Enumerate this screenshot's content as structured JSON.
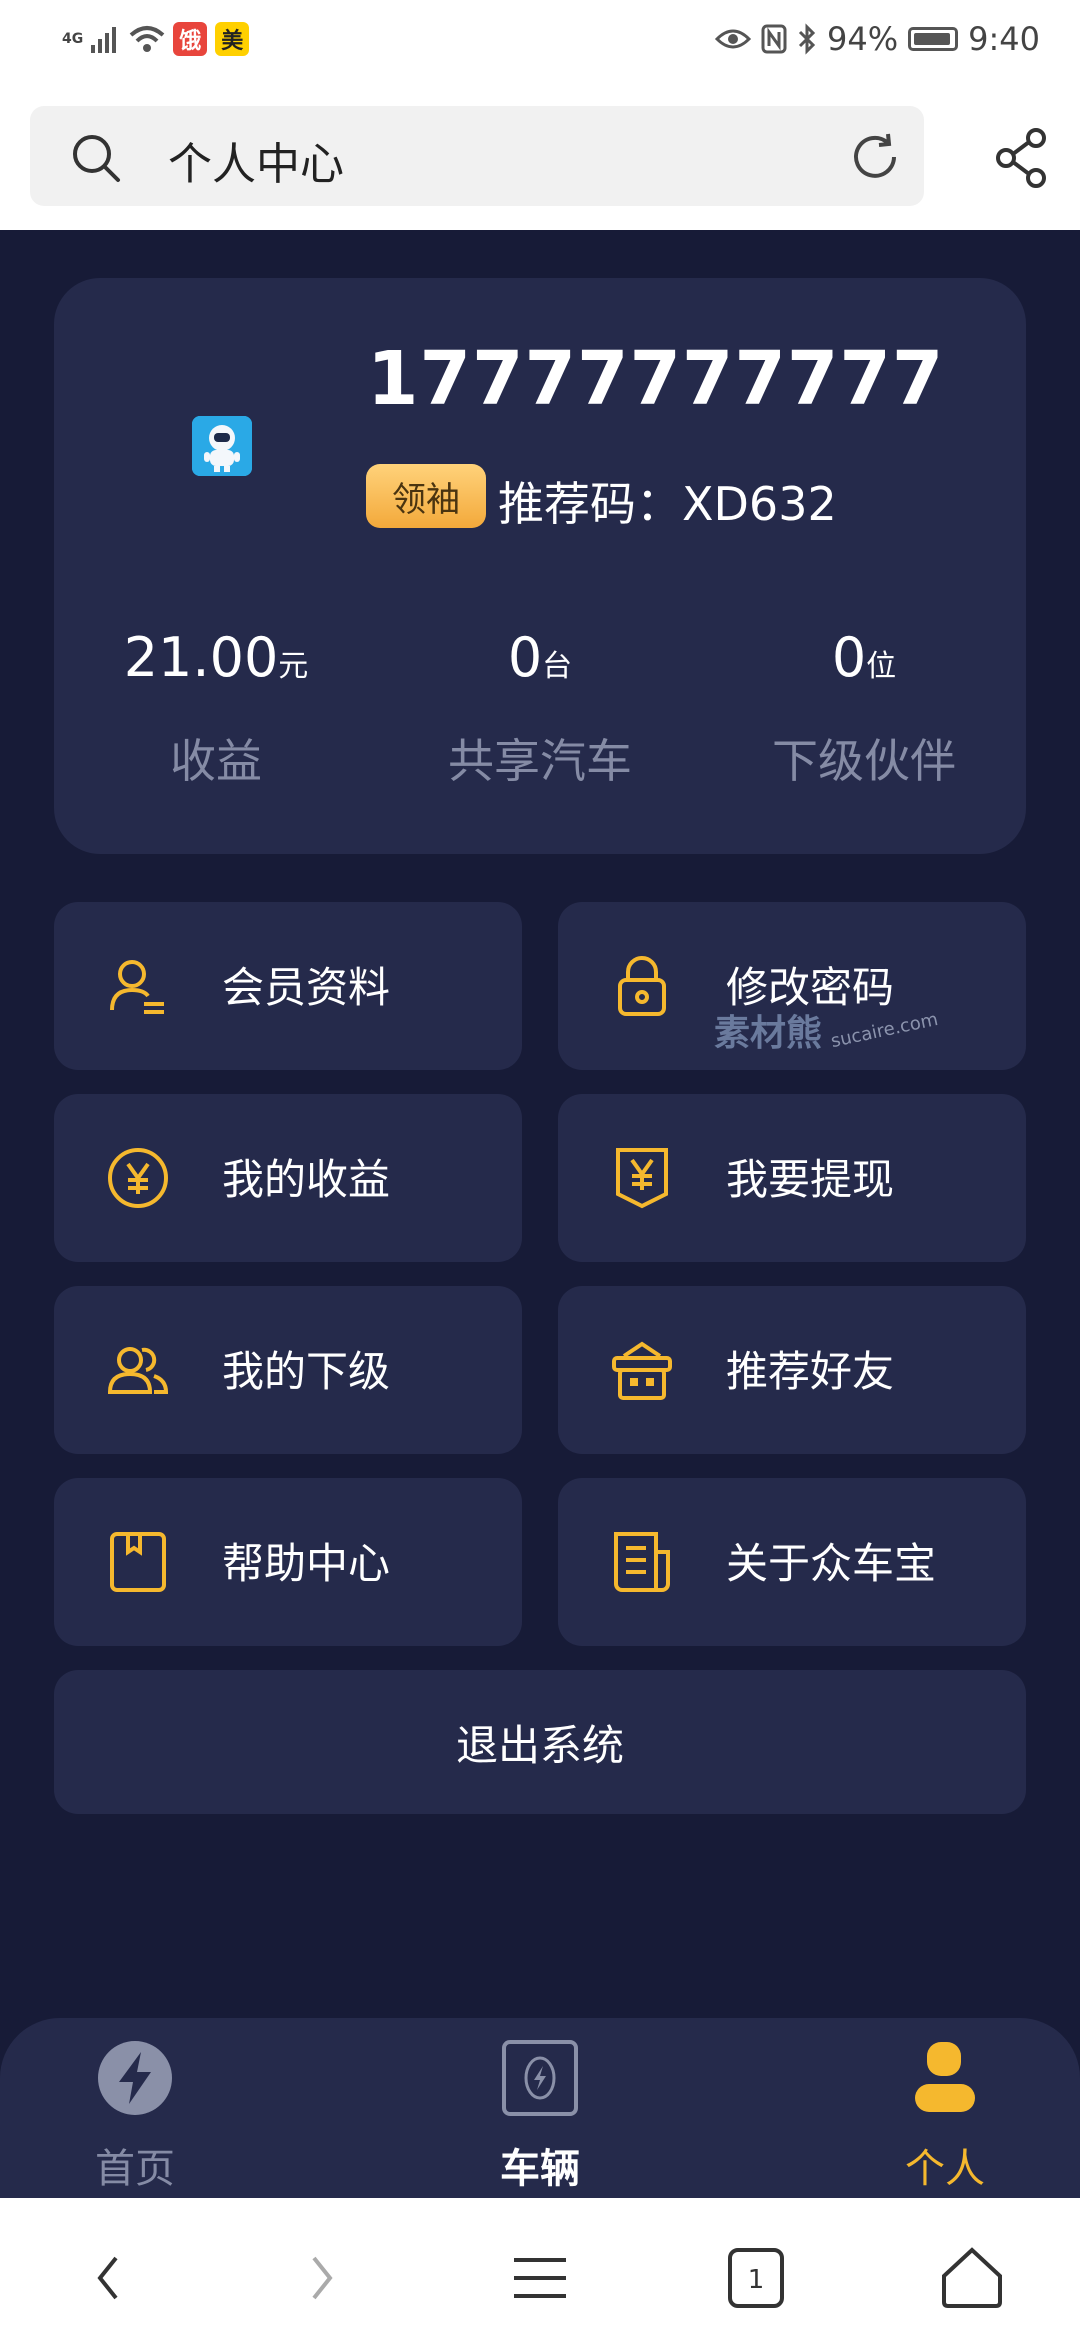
{
  "status_bar": {
    "network": "4G",
    "app1": "饿",
    "app2": "美",
    "battery": "94%",
    "time": "9:40"
  },
  "header": {
    "search_text": "个人中心",
    "icons": [
      "search-icon",
      "refresh-icon",
      "share-icon"
    ]
  },
  "profile": {
    "phone": "17777777777",
    "badge": "领袖",
    "ref_label": "推荐码：XD632",
    "stats": [
      {
        "value": "21.00",
        "unit": "元",
        "label": "收益"
      },
      {
        "value": "0",
        "unit": "台",
        "label": "共享汽车"
      },
      {
        "value": "0",
        "unit": "位",
        "label": "下级伙伴"
      }
    ]
  },
  "menu": [
    {
      "label": "会员资料",
      "icon": "user-card-icon"
    },
    {
      "label": "修改密码",
      "icon": "lock-icon"
    },
    {
      "label": "我的收益",
      "icon": "yen-circle-icon"
    },
    {
      "label": "我要提现",
      "icon": "withdraw-icon"
    },
    {
      "label": "我的下级",
      "icon": "group-icon"
    },
    {
      "label": "推荐好友",
      "icon": "gift-box-icon"
    },
    {
      "label": "帮助中心",
      "icon": "help-book-icon"
    },
    {
      "label": "关于众车宝",
      "icon": "document-icon"
    }
  ],
  "logout_label": "退出系统",
  "watermark": {
    "main": "素材熊",
    "sub": "sucaire.com"
  },
  "tabs": [
    {
      "label": "首页",
      "icon": "lightning-icon",
      "state": "inactive"
    },
    {
      "label": "车辆",
      "icon": "charger-icon",
      "state": "bold"
    },
    {
      "label": "个人",
      "icon": "person-icon",
      "state": "active"
    }
  ],
  "colors": {
    "background": "#171b37",
    "card": "#252a4b",
    "accent": "#f5b82e",
    "muted": "#858ba5"
  }
}
